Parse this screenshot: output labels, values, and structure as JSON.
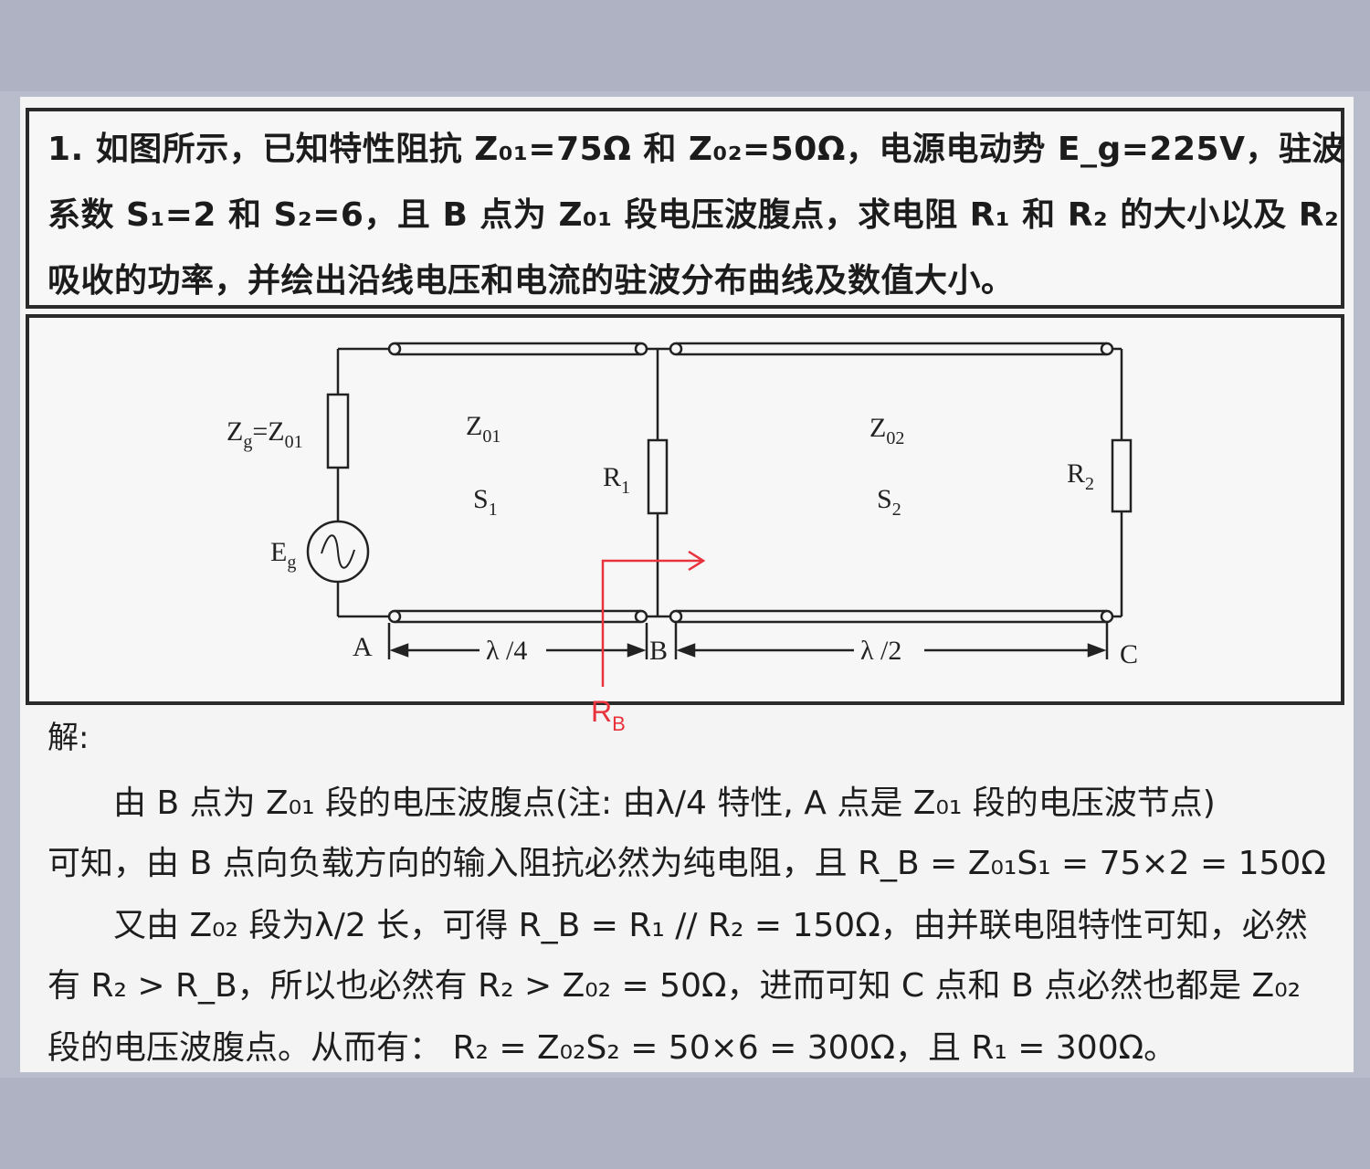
{
  "question": {
    "line1": "1. 如图所示，已知特性阻抗 Z₀₁=75Ω 和 Z₀₂=50Ω，电源电动势 E_g=225V，驻波",
    "line2": "系数 S₁=2 和 S₂=6，且 B 点为 Z₀₁ 段电压波腹点，求电阻 R₁ 和 R₂ 的大小以及 R₂",
    "line3": "吸收的功率，并绘出沿线电压和电流的驻波分布曲线及数值大小。"
  },
  "circuit": {
    "zg_label": "Z",
    "zg_sub": "g",
    "zg_eq": "=Z",
    "zg_sub2": "01",
    "eg_label": "E",
    "eg_sub": "g",
    "z01_label": "Z",
    "z01_sub": "01",
    "s1_label": "S",
    "s1_sub": "1",
    "r1_label": "R",
    "r1_sub": "1",
    "z02_label": "Z",
    "z02_sub": "02",
    "s2_label": "S",
    "s2_sub": "2",
    "r2_label": "R",
    "r2_sub": "2",
    "point_a": "A",
    "point_b": "B",
    "point_c": "C",
    "quarter_wave": "λ /4",
    "half_wave": "λ /2",
    "rb_label": "R",
    "rb_sub": "B",
    "annotation_color": "#e8323c"
  },
  "solution": {
    "heading": "解:",
    "p1": "由 B 点为 Z₀₁ 段的电压波腹点(注: 由λ/4 特性, A 点是 Z₀₁ 段的电压波节点)",
    "p2": "可知，由 B 点向负载方向的输入阻抗必然为纯电阻，且 R_B = Z₀₁S₁ = 75×2 = 150Ω",
    "p3": "又由 Z₀₂ 段为λ/2 长，可得 R_B = R₁ // R₂ = 150Ω，由并联电阻特性可知，必然",
    "p4": "有 R₂ > R_B，所以也必然有 R₂ > Z₀₂ = 50Ω，进而可知 C 点和 B 点必然也都是 Z₀₂",
    "p5": "段的电压波腹点。从而有：      R₂ = Z₀₂S₂ = 50×6 = 300Ω，且  R₁ = 300Ω。"
  }
}
